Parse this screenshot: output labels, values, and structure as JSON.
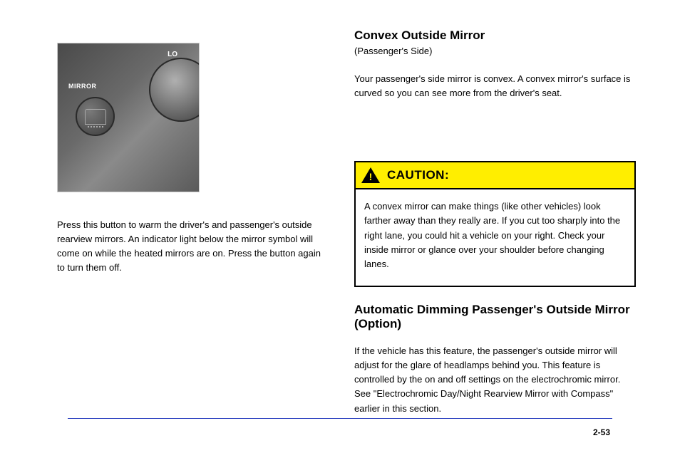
{
  "photo": {
    "lo_label": "LO",
    "mirror_label": "MIRROR"
  },
  "left": {
    "body1": "Press this button to warm the driver's and passenger's outside rearview mirrors. An indicator light below the mirror symbol will come on while the heated mirrors are on. Press the button again to turn them off."
  },
  "right": {
    "heading": "Convex Outside Mirror",
    "sub": "(Passenger's Side)",
    "upper": "Your passenger's side mirror is convex. A convex mirror's surface is curved so you can see more from the driver's seat."
  },
  "caution": {
    "title": "CAUTION:",
    "body": "A convex mirror can make things (like other vehicles) look farther away than they really are. If you cut too sharply into the right lane, you could hit a vehicle on your right. Check your inside mirror or glance over your shoulder before changing lanes."
  },
  "below_caution": {
    "heading": "Automatic Dimming Passenger's Outside Mirror (Option)",
    "body": "If the vehicle has this feature, the passenger's outside mirror will adjust for the glare of headlamps behind you. This feature is controlled by the on and off settings on the electrochromic mirror. See \"Electrochromic Day/Night Rearview Mirror with Compass\" earlier in this section."
  },
  "page_number": "2-53"
}
